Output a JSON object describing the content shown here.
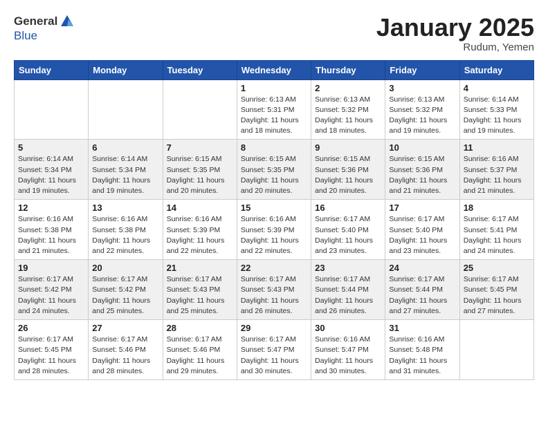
{
  "header": {
    "logo_general": "General",
    "logo_blue": "Blue",
    "month_title": "January 2025",
    "subtitle": "Rudum, Yemen"
  },
  "days_of_week": [
    "Sunday",
    "Monday",
    "Tuesday",
    "Wednesday",
    "Thursday",
    "Friday",
    "Saturday"
  ],
  "weeks": [
    [
      {
        "day": "",
        "info": ""
      },
      {
        "day": "",
        "info": ""
      },
      {
        "day": "",
        "info": ""
      },
      {
        "day": "1",
        "info": "Sunrise: 6:13 AM\nSunset: 5:31 PM\nDaylight: 11 hours and 18 minutes."
      },
      {
        "day": "2",
        "info": "Sunrise: 6:13 AM\nSunset: 5:32 PM\nDaylight: 11 hours and 18 minutes."
      },
      {
        "day": "3",
        "info": "Sunrise: 6:13 AM\nSunset: 5:32 PM\nDaylight: 11 hours and 19 minutes."
      },
      {
        "day": "4",
        "info": "Sunrise: 6:14 AM\nSunset: 5:33 PM\nDaylight: 11 hours and 19 minutes."
      }
    ],
    [
      {
        "day": "5",
        "info": "Sunrise: 6:14 AM\nSunset: 5:34 PM\nDaylight: 11 hours and 19 minutes."
      },
      {
        "day": "6",
        "info": "Sunrise: 6:14 AM\nSunset: 5:34 PM\nDaylight: 11 hours and 19 minutes."
      },
      {
        "day": "7",
        "info": "Sunrise: 6:15 AM\nSunset: 5:35 PM\nDaylight: 11 hours and 20 minutes."
      },
      {
        "day": "8",
        "info": "Sunrise: 6:15 AM\nSunset: 5:35 PM\nDaylight: 11 hours and 20 minutes."
      },
      {
        "day": "9",
        "info": "Sunrise: 6:15 AM\nSunset: 5:36 PM\nDaylight: 11 hours and 20 minutes."
      },
      {
        "day": "10",
        "info": "Sunrise: 6:15 AM\nSunset: 5:36 PM\nDaylight: 11 hours and 21 minutes."
      },
      {
        "day": "11",
        "info": "Sunrise: 6:16 AM\nSunset: 5:37 PM\nDaylight: 11 hours and 21 minutes."
      }
    ],
    [
      {
        "day": "12",
        "info": "Sunrise: 6:16 AM\nSunset: 5:38 PM\nDaylight: 11 hours and 21 minutes."
      },
      {
        "day": "13",
        "info": "Sunrise: 6:16 AM\nSunset: 5:38 PM\nDaylight: 11 hours and 22 minutes."
      },
      {
        "day": "14",
        "info": "Sunrise: 6:16 AM\nSunset: 5:39 PM\nDaylight: 11 hours and 22 minutes."
      },
      {
        "day": "15",
        "info": "Sunrise: 6:16 AM\nSunset: 5:39 PM\nDaylight: 11 hours and 22 minutes."
      },
      {
        "day": "16",
        "info": "Sunrise: 6:17 AM\nSunset: 5:40 PM\nDaylight: 11 hours and 23 minutes."
      },
      {
        "day": "17",
        "info": "Sunrise: 6:17 AM\nSunset: 5:40 PM\nDaylight: 11 hours and 23 minutes."
      },
      {
        "day": "18",
        "info": "Sunrise: 6:17 AM\nSunset: 5:41 PM\nDaylight: 11 hours and 24 minutes."
      }
    ],
    [
      {
        "day": "19",
        "info": "Sunrise: 6:17 AM\nSunset: 5:42 PM\nDaylight: 11 hours and 24 minutes."
      },
      {
        "day": "20",
        "info": "Sunrise: 6:17 AM\nSunset: 5:42 PM\nDaylight: 11 hours and 25 minutes."
      },
      {
        "day": "21",
        "info": "Sunrise: 6:17 AM\nSunset: 5:43 PM\nDaylight: 11 hours and 25 minutes."
      },
      {
        "day": "22",
        "info": "Sunrise: 6:17 AM\nSunset: 5:43 PM\nDaylight: 11 hours and 26 minutes."
      },
      {
        "day": "23",
        "info": "Sunrise: 6:17 AM\nSunset: 5:44 PM\nDaylight: 11 hours and 26 minutes."
      },
      {
        "day": "24",
        "info": "Sunrise: 6:17 AM\nSunset: 5:44 PM\nDaylight: 11 hours and 27 minutes."
      },
      {
        "day": "25",
        "info": "Sunrise: 6:17 AM\nSunset: 5:45 PM\nDaylight: 11 hours and 27 minutes."
      }
    ],
    [
      {
        "day": "26",
        "info": "Sunrise: 6:17 AM\nSunset: 5:45 PM\nDaylight: 11 hours and 28 minutes."
      },
      {
        "day": "27",
        "info": "Sunrise: 6:17 AM\nSunset: 5:46 PM\nDaylight: 11 hours and 28 minutes."
      },
      {
        "day": "28",
        "info": "Sunrise: 6:17 AM\nSunset: 5:46 PM\nDaylight: 11 hours and 29 minutes."
      },
      {
        "day": "29",
        "info": "Sunrise: 6:17 AM\nSunset: 5:47 PM\nDaylight: 11 hours and 30 minutes."
      },
      {
        "day": "30",
        "info": "Sunrise: 6:16 AM\nSunset: 5:47 PM\nDaylight: 11 hours and 30 minutes."
      },
      {
        "day": "31",
        "info": "Sunrise: 6:16 AM\nSunset: 5:48 PM\nDaylight: 11 hours and 31 minutes."
      },
      {
        "day": "",
        "info": ""
      }
    ]
  ]
}
